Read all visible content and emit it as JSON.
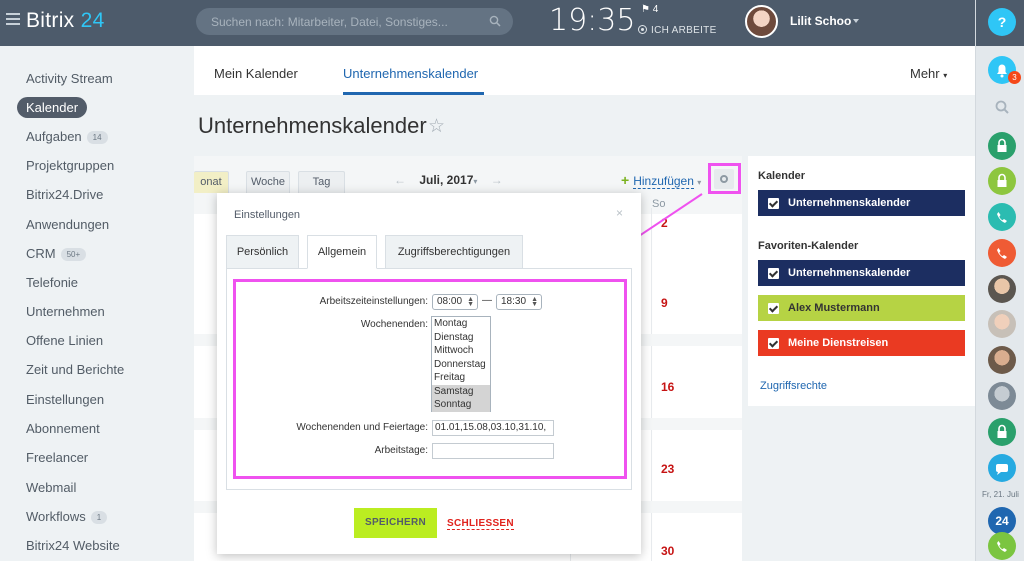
{
  "header": {
    "logo_text": "Bitrix",
    "logo_num": "24",
    "search_placeholder": "Suchen nach: Mitarbeiter, Datei, Sonstiges...",
    "clock": "19:35",
    "flag_count": "4",
    "work_status": "ICH ARBEITE",
    "user_name": "Lilit Schoo"
  },
  "rightbar": {
    "help": "?",
    "notification_count": "3",
    "date": "Fr, 21. Juli",
    "colors": {
      "lock": "#55b63b",
      "phone_teal": "#2bbcb1",
      "phone_red": "#ef5b34",
      "lock_green": "#2aa06c",
      "chat": "#26aae1",
      "b24": "#2067b0",
      "call": "#7bc540"
    }
  },
  "leftmenu": {
    "items": [
      {
        "label": "Activity Stream"
      },
      {
        "label": "Kalender"
      },
      {
        "label": "Aufgaben",
        "count": "14"
      },
      {
        "label": "Projektgruppen"
      },
      {
        "label": "Bitrix24.Drive"
      },
      {
        "label": "Anwendungen"
      },
      {
        "label": "CRM",
        "count": "50+"
      },
      {
        "label": "Telefonie"
      },
      {
        "label": "Unternehmen"
      },
      {
        "label": "Offene Linien"
      },
      {
        "label": "Zeit und Berichte"
      },
      {
        "label": "Einstellungen"
      },
      {
        "label": "Abonnement"
      },
      {
        "label": "Freelancer"
      },
      {
        "label": "Webmail"
      },
      {
        "label": "Workflows",
        "count": "1"
      },
      {
        "label": "Bitrix24 Website"
      }
    ]
  },
  "tabs": {
    "my_calendar": "Mein Kalender",
    "company_calendar": "Unternehmenskalender",
    "more": "Mehr"
  },
  "page": {
    "title": "Unternehmenskalender"
  },
  "calendar": {
    "view_tabs": [
      "onat",
      "Woche",
      "Tag"
    ],
    "month": "Juli, 2017",
    "prev": "←",
    "next": "→",
    "add": "Hinzufügen",
    "col_head": "So",
    "day_numbers": [
      "2",
      "9",
      "16",
      "23",
      "30"
    ]
  },
  "calpanel": {
    "heading_calendars": "Kalender",
    "calendars": [
      {
        "label": "Unternehmenskalender",
        "color": "#1c2e61"
      }
    ],
    "heading_favorites": "Favoriten-Kalender",
    "favorites": [
      {
        "label": "Unternehmenskalender",
        "color": "#1c2e61"
      },
      {
        "label": "Alex Mustermann",
        "color": "#b6d344"
      },
      {
        "label": "Meine Dienstreisen",
        "color": "#ea3a22"
      }
    ],
    "access_link": "Zugriffsrechte"
  },
  "dialog": {
    "title": "Einstellungen",
    "close": "×",
    "tabs": [
      "Persönlich",
      "Allgemein",
      "Zugriffsberechtigungen"
    ],
    "work_time_label": "Arbeitszeiteinstellungen:",
    "work_start": "08:00",
    "work_dash": "—",
    "work_end": "18:30",
    "weekends_label": "Wochenenden:",
    "weekdays": [
      {
        "label": "Montag",
        "selected": false
      },
      {
        "label": "Dienstag",
        "selected": false
      },
      {
        "label": "Mittwoch",
        "selected": false
      },
      {
        "label": "Donnerstag",
        "selected": false
      },
      {
        "label": "Freitag",
        "selected": false
      },
      {
        "label": "Samstag",
        "selected": true
      },
      {
        "label": "Sonntag",
        "selected": true
      }
    ],
    "holidays_label": "Wochenenden und Feiertage:",
    "holidays_value": "01.01,15.08,03.10,31.10,",
    "workdays_label": "Arbeitstage:",
    "workdays_value": "",
    "save": "SPEICHERN",
    "close_button": "SCHLIESSEN"
  }
}
